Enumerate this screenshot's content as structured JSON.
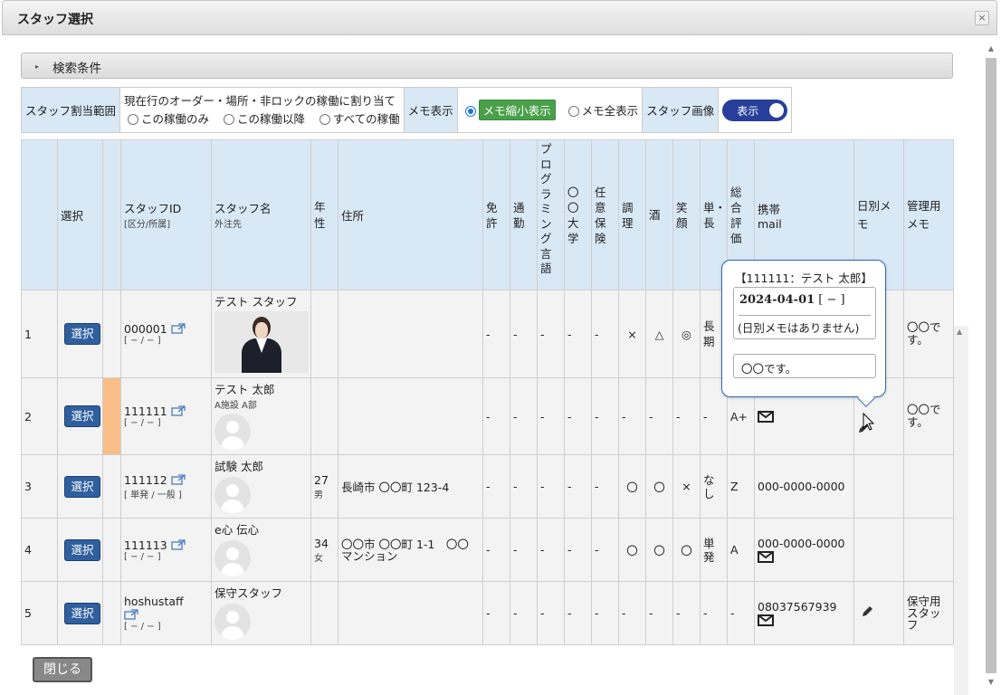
{
  "dialog": {
    "title": "スタッフ選択",
    "close_glyph": "×"
  },
  "search": {
    "label": "検索条件",
    "arrow": "▸"
  },
  "options": {
    "assign_label": "スタッフ割当範囲",
    "assign_desc": "現在行のオーダー・場所・非ロックの稼働に割り当て",
    "assign_choices": [
      "この稼働のみ",
      "この稼働以降",
      "すべての稼働"
    ],
    "memo_label": "メモ表示",
    "memo_choices": [
      "メモ縮小表示",
      "メモ全表示"
    ],
    "image_label": "スタッフ画像",
    "image_toggle": "表示"
  },
  "columns": {
    "select": "選択",
    "staff_id": "スタッフID",
    "staff_id_sub": "[区分/所属]",
    "staff_name": "スタッフ名",
    "staff_name_sub": "外注先",
    "age_sex": "年性",
    "address": "住所",
    "license": "免許",
    "commute": "通勤",
    "programming": "プログラミング言語",
    "university": "〇〇大学",
    "insurance": "任意保険",
    "cooking": "調理",
    "alcohol": "酒",
    "smile": "笑顔",
    "single_long": "単・長",
    "overall": "総合評価",
    "mobile": "携帯",
    "mail": "mail",
    "daily_memo": "日別メモ",
    "admin_memo": "管理用メモ"
  },
  "rows": [
    {
      "no": "1",
      "btn": "選択",
      "id": "000001",
      "div": "[ − / − ]",
      "name": "テスト スタッフ",
      "sub": "",
      "age": "",
      "sex": "",
      "address": "",
      "license": "-",
      "commute": "-",
      "prog": "-",
      "univ": "-",
      "insurance": "-",
      "cooking": "×",
      "alcohol": "△",
      "smile": "◎",
      "single_long": "長期",
      "overall": "",
      "mobile": "",
      "memo": "",
      "admin": "〇〇です。"
    },
    {
      "no": "2",
      "btn": "選択",
      "id": "111111",
      "div": "[ − / − ]",
      "name": "テスト 太郎",
      "sub": "A施設 A部",
      "age": "",
      "sex": "",
      "address": "",
      "license": "-",
      "commute": "-",
      "prog": "-",
      "univ": "-",
      "insurance": "-",
      "cooking": "-",
      "alcohol": "-",
      "smile": "-",
      "single_long": "-",
      "overall": "A+",
      "mobile": "",
      "memo": "",
      "admin": "〇〇です。"
    },
    {
      "no": "3",
      "btn": "選択",
      "id": "111112",
      "div": "[ 単発 / 一般 ]",
      "name": "試験 太郎",
      "sub": "",
      "age": "27",
      "sex": "男",
      "address": "長崎市 〇〇町 123-4",
      "license": "-",
      "commute": "-",
      "prog": "-",
      "univ": "-",
      "insurance": "-",
      "cooking": "〇",
      "alcohol": "〇",
      "smile": "×",
      "single_long": "なし",
      "overall": "Z",
      "mobile": "000-0000-0000",
      "memo": "",
      "admin": ""
    },
    {
      "no": "4",
      "btn": "選択",
      "id": "111113",
      "div": "[ − / − ]",
      "name": "e心 伝心",
      "sub": "",
      "age": "34",
      "sex": "女",
      "address": "〇〇市 〇〇町 1-1　〇〇マンション",
      "license": "-",
      "commute": "-",
      "prog": "-",
      "univ": "-",
      "insurance": "-",
      "cooking": "〇",
      "alcohol": "〇",
      "smile": "〇",
      "single_long": "単発",
      "overall": "A",
      "mobile": "000-0000-0000",
      "memo": "",
      "admin": ""
    },
    {
      "no": "5",
      "btn": "選択",
      "id": "hoshustaff",
      "div": "[ − / − ]",
      "name": "保守スタッフ",
      "sub": "",
      "age": "",
      "sex": "",
      "address": "",
      "license": "-",
      "commute": "-",
      "prog": "-",
      "univ": "-",
      "insurance": "-",
      "cooking": "-",
      "alcohol": "-",
      "smile": "-",
      "single_long": "-",
      "overall": "-",
      "mobile": "08037567939",
      "memo": "",
      "admin": "保守用スタッフ"
    }
  ],
  "popup": {
    "header": "【111111：テスト 太郎】",
    "date": "2024-04-01",
    "date_suffix": " [ − ]",
    "no_memo": "(日別メモはありません)",
    "memo": "〇〇です。"
  },
  "footer": {
    "close_label": "閉じる"
  },
  "colors": {
    "header_bg": "#d9e8f5",
    "select_btn": "#2f5f9e",
    "toggle": "#273f9a",
    "memo_badge": "#4aa04a",
    "flag": "#f9bd88"
  }
}
